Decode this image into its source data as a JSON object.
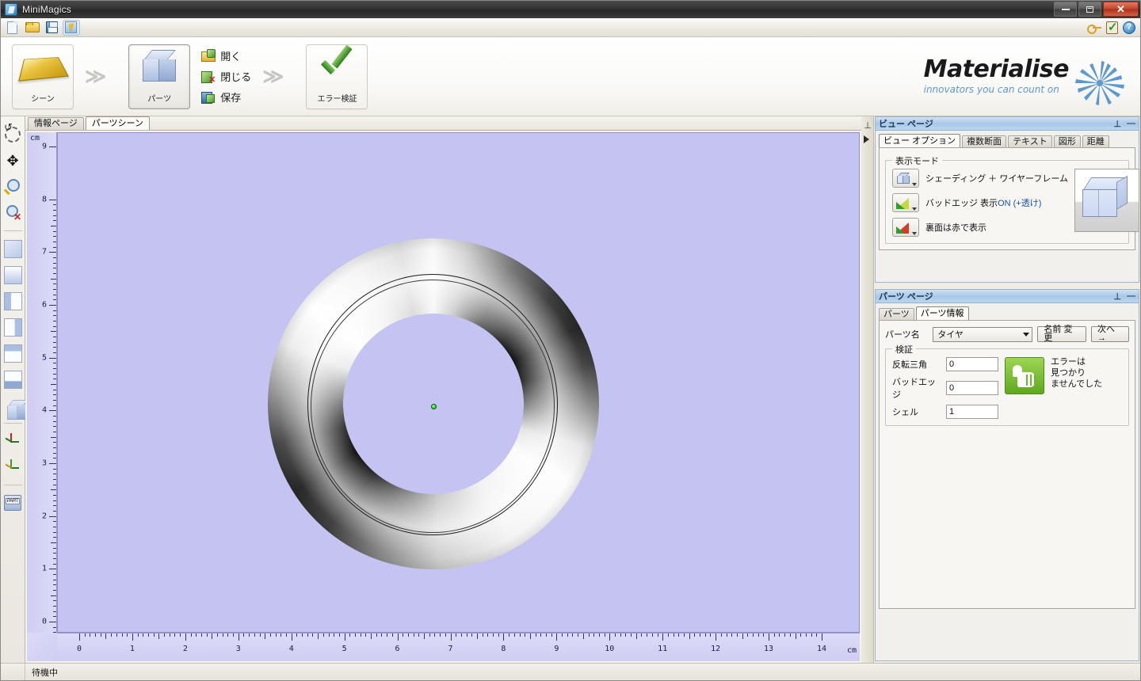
{
  "window": {
    "title": "MiniMagics",
    "icon": "app-icon",
    "minimize": "minimize",
    "restore": "restore",
    "close": "close"
  },
  "quickbar": {
    "items": [
      {
        "name": "new-icon",
        "label": "新規"
      },
      {
        "name": "open-icon",
        "label": "開く"
      },
      {
        "name": "save-icon",
        "label": "保存"
      },
      {
        "name": "select-cursor-icon",
        "label": "選択"
      }
    ],
    "right_items": [
      {
        "name": "key-icon",
        "label": "ライセンス"
      },
      {
        "name": "clipboard-check-icon",
        "label": "チェック"
      },
      {
        "name": "help-icon",
        "label": "?"
      }
    ]
  },
  "ribbon": {
    "scene_button": "シーン",
    "part_button": "パーツ",
    "error_button": "エラー検証",
    "chevron": "≫",
    "commands": [
      {
        "label": "開く",
        "icon": "open-folder-icon"
      },
      {
        "label": "閉じる",
        "icon": "close-part-icon"
      },
      {
        "label": "保存",
        "icon": "save-part-icon"
      }
    ],
    "brand": {
      "name": "Materialise",
      "tagline": "innovators you can count on"
    }
  },
  "rail": {
    "tools": [
      {
        "name": "rotate-tool",
        "label": "回転"
      },
      {
        "name": "pan-tool",
        "label": "移動"
      },
      {
        "name": "zoom-tool",
        "label": "ズーム"
      },
      {
        "name": "zoom-reset-tool",
        "label": "ズームリセット"
      },
      {
        "name": "view-iso-tool",
        "label": "アイソメ表示"
      },
      {
        "name": "view-front-tool",
        "label": "正面表示"
      },
      {
        "name": "view-left-tool",
        "label": "左面表示"
      },
      {
        "name": "view-right-tool",
        "label": "右面表示"
      },
      {
        "name": "view-top-tool",
        "label": "上面表示"
      },
      {
        "name": "view-bottom-tool",
        "label": "下面表示"
      },
      {
        "name": "view-shaded-tool",
        "label": "シェーディング"
      },
      {
        "name": "axis-tool",
        "label": "座標軸"
      },
      {
        "name": "axis-rotate-tool",
        "label": "座標軸回転"
      },
      {
        "name": "part-tool",
        "label": "PART"
      }
    ]
  },
  "workarea": {
    "tabs": [
      {
        "label": "情報ページ",
        "active": false
      },
      {
        "label": "パーツシーン",
        "active": true
      }
    ],
    "ruler": {
      "unit": "cm",
      "x_labels": [
        "0",
        "1",
        "2",
        "3",
        "4",
        "5",
        "6",
        "7",
        "8",
        "9",
        "10",
        "11",
        "12",
        "13",
        "14"
      ],
      "y_labels": [
        "0",
        "1",
        "2",
        "3",
        "4",
        "5",
        "6",
        "7",
        "8",
        "9"
      ],
      "x_min": 0,
      "x_max": 14,
      "y_min": 0,
      "y_max": 9
    },
    "model": {
      "name": "tire-torus-model",
      "origin_marker": "origin-dot",
      "origin_color": "#08b308"
    },
    "background_color": "#c5c3f2"
  },
  "view_panel": {
    "title": "ビュー ページ",
    "pin": "⊥",
    "minimize": "―",
    "tabs": [
      {
        "label": "ビュー オプション",
        "active": true
      },
      {
        "label": "複数断面",
        "active": false
      },
      {
        "label": "テキスト",
        "active": false
      },
      {
        "label": "図形",
        "active": false
      },
      {
        "label": "距離",
        "active": false
      }
    ],
    "group_label": "表示モード",
    "modes": [
      {
        "icon": "shading-cube-icon",
        "label": "シェーディング ＋ ワイヤーフレーム",
        "blue_suffix": ""
      },
      {
        "icon": "bad-edge-icon",
        "label": "バッドエッジ 表示",
        "blue_suffix": "ON (+透け)"
      },
      {
        "icon": "back-face-red-icon",
        "label": "裏面は赤で表示",
        "blue_suffix": ""
      }
    ],
    "preview": "cube-preview",
    "preview_scroll": "preview-dropdown"
  },
  "parts_panel": {
    "title": "パーツ ページ",
    "pin": "⊥",
    "minimize": "―",
    "tabs": [
      {
        "label": "パーツ",
        "active": false
      },
      {
        "label": "パーツ情報",
        "active": true
      }
    ],
    "part_name_label": "パーツ名",
    "part_name_value": "タイヤ",
    "rename_button": "名前 変更",
    "next_button": "次へ→",
    "validation_group": "検証",
    "fields": [
      {
        "label": "反転三角",
        "value": "0"
      },
      {
        "label": "バッドエッジ",
        "value": "0"
      },
      {
        "label": "シェル",
        "value": "1"
      }
    ],
    "status_badge": "thumbs-up-icon",
    "status_lines": [
      "エラーは",
      "見つかり",
      "ませんでした"
    ],
    "status_color": "#6cb82a"
  },
  "statusbar": {
    "text": "待機中"
  }
}
